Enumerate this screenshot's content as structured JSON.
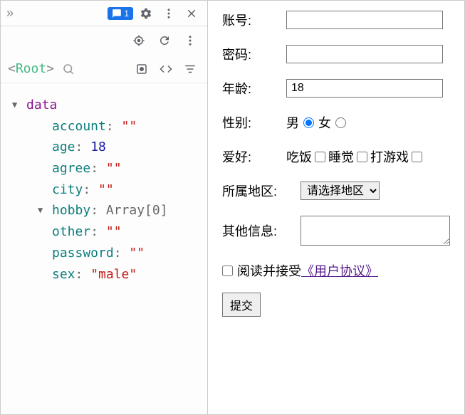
{
  "devtools": {
    "msg_count": "1",
    "root_label_lt": "<",
    "root_label_name": "Root",
    "root_label_gt": ">"
  },
  "tree": {
    "data_label": "data",
    "props": {
      "account_key": "account",
      "account_val": "\"\"",
      "age_key": "age",
      "age_val": "18",
      "agree_key": "agree",
      "agree_val": "\"\"",
      "city_key": "city",
      "city_val": "\"\"",
      "hobby_key": "hobby",
      "hobby_val": "Array[0]",
      "other_key": "other",
      "other_val": "\"\"",
      "password_key": "password",
      "password_val": "\"\"",
      "sex_key": "sex",
      "sex_val": "\"male\""
    }
  },
  "form": {
    "account_label": "账号:",
    "account_value": "",
    "password_label": "密码:",
    "password_value": "",
    "age_label": "年龄:",
    "age_value": "18",
    "sex_label": "性别:",
    "sex_male": "男",
    "sex_female": "女",
    "hobby_label": "爱好:",
    "hobby_eat": "吃饭",
    "hobby_sleep": "睡觉",
    "hobby_game": "打游戏",
    "region_label": "所属地区:",
    "region_placeholder": "请选择地区",
    "other_label": "其他信息:",
    "other_value": "",
    "agree_text": "阅读并接受",
    "agree_link": "《用户协议》",
    "submit_label": "提交"
  }
}
